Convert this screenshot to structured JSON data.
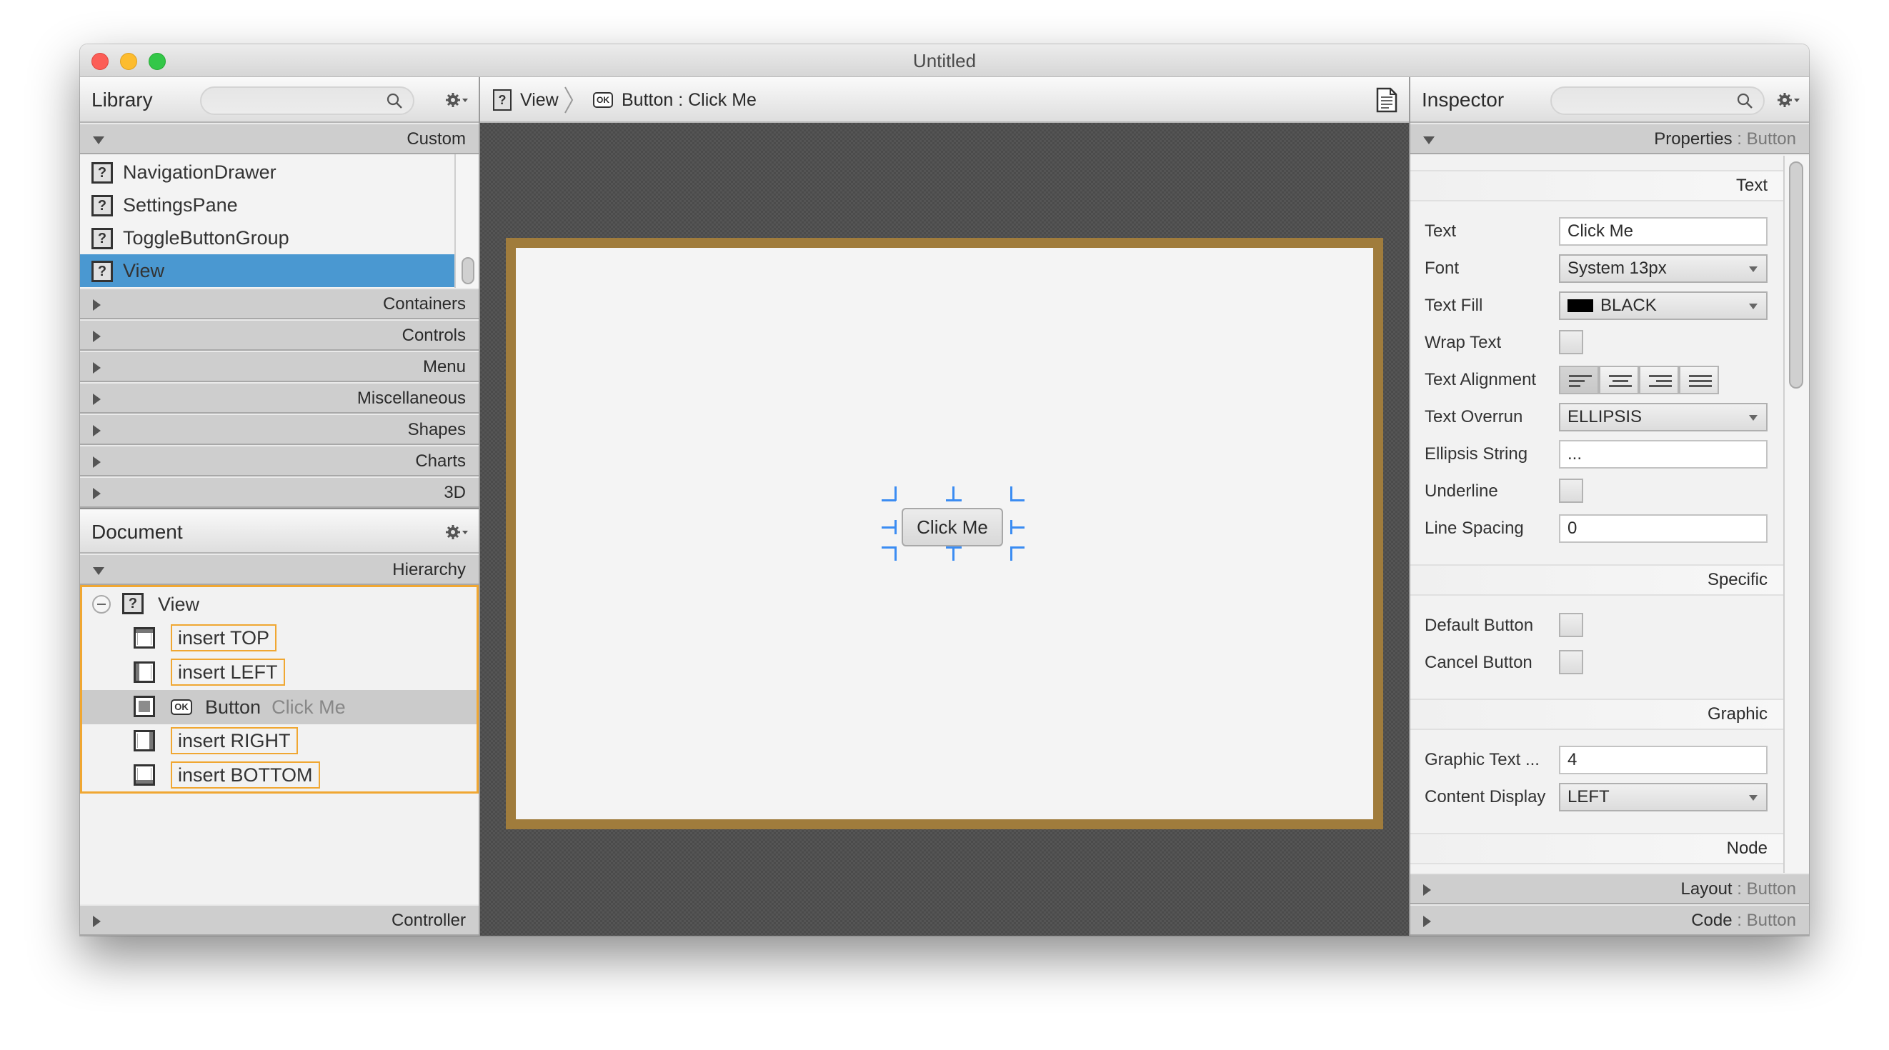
{
  "window": {
    "title": "Untitled"
  },
  "library": {
    "title": "Library",
    "search_placeholder": "",
    "custom_section": "Custom",
    "items": [
      {
        "label": "NavigationDrawer",
        "icon": "unknown-component-icon"
      },
      {
        "label": "SettingsPane",
        "icon": "unknown-component-icon"
      },
      {
        "label": "ToggleButtonGroup",
        "icon": "unknown-component-icon"
      },
      {
        "label": "View",
        "icon": "unknown-component-icon",
        "selected": true
      }
    ],
    "categories": [
      "Containers",
      "Controls",
      "Menu",
      "Miscellaneous",
      "Shapes",
      "Charts",
      "3D"
    ]
  },
  "document": {
    "title": "Document",
    "hierarchy_section": "Hierarchy",
    "root": {
      "label": "View",
      "icon": "unknown-component-icon"
    },
    "children": [
      {
        "label": "insert TOP",
        "icon": "region-top-icon"
      },
      {
        "label": "insert LEFT",
        "icon": "region-left-icon"
      },
      {
        "label": "Button",
        "secondary": "Click Me",
        "icon": "region-center-icon",
        "type_icon": "OK"
      },
      {
        "label": "insert RIGHT",
        "icon": "region-right-icon"
      },
      {
        "label": "insert BOTTOM",
        "icon": "region-bottom-icon"
      }
    ],
    "controller_section": "Controller"
  },
  "breadcrumb": {
    "items": [
      {
        "label": "View",
        "icon": "?"
      },
      {
        "label": "Button : Click Me",
        "icon": "OK"
      }
    ]
  },
  "canvas": {
    "button_label": "Click Me",
    "border_color": "#a07c3c",
    "selection_color": "#3b8cf2"
  },
  "inspector": {
    "title": "Inspector",
    "search_placeholder": "",
    "properties_section": {
      "title": "Properties",
      "subject": "Button"
    },
    "groups": {
      "text": "Text",
      "specific": "Specific",
      "graphic": "Graphic",
      "node": "Node"
    },
    "properties": {
      "text": {
        "label": "Text",
        "value": "Click Me"
      },
      "font": {
        "label": "Font",
        "value": "System 13px"
      },
      "text_fill": {
        "label": "Text Fill",
        "value": "BLACK",
        "color": "#000000"
      },
      "wrap_text": {
        "label": "Wrap Text",
        "checked": false
      },
      "text_alignment": {
        "label": "Text Alignment",
        "options": [
          "left",
          "center",
          "right",
          "justify"
        ],
        "selected": "left"
      },
      "text_overrun": {
        "label": "Text Overrun",
        "value": "ELLIPSIS"
      },
      "ellipsis_string": {
        "label": "Ellipsis String",
        "value": "..."
      },
      "underline": {
        "label": "Underline",
        "checked": false
      },
      "line_spacing": {
        "label": "Line Spacing",
        "value": "0"
      },
      "default_button": {
        "label": "Default Button",
        "checked": false
      },
      "cancel_button": {
        "label": "Cancel Button",
        "checked": false
      },
      "graphic_text_gap": {
        "label": "Graphic Text ...",
        "value": "4"
      },
      "content_display": {
        "label": "Content Display",
        "value": "LEFT"
      }
    },
    "layout_section": {
      "title": "Layout",
      "subject": "Button"
    },
    "code_section": {
      "title": "Code",
      "subject": "Button"
    }
  }
}
